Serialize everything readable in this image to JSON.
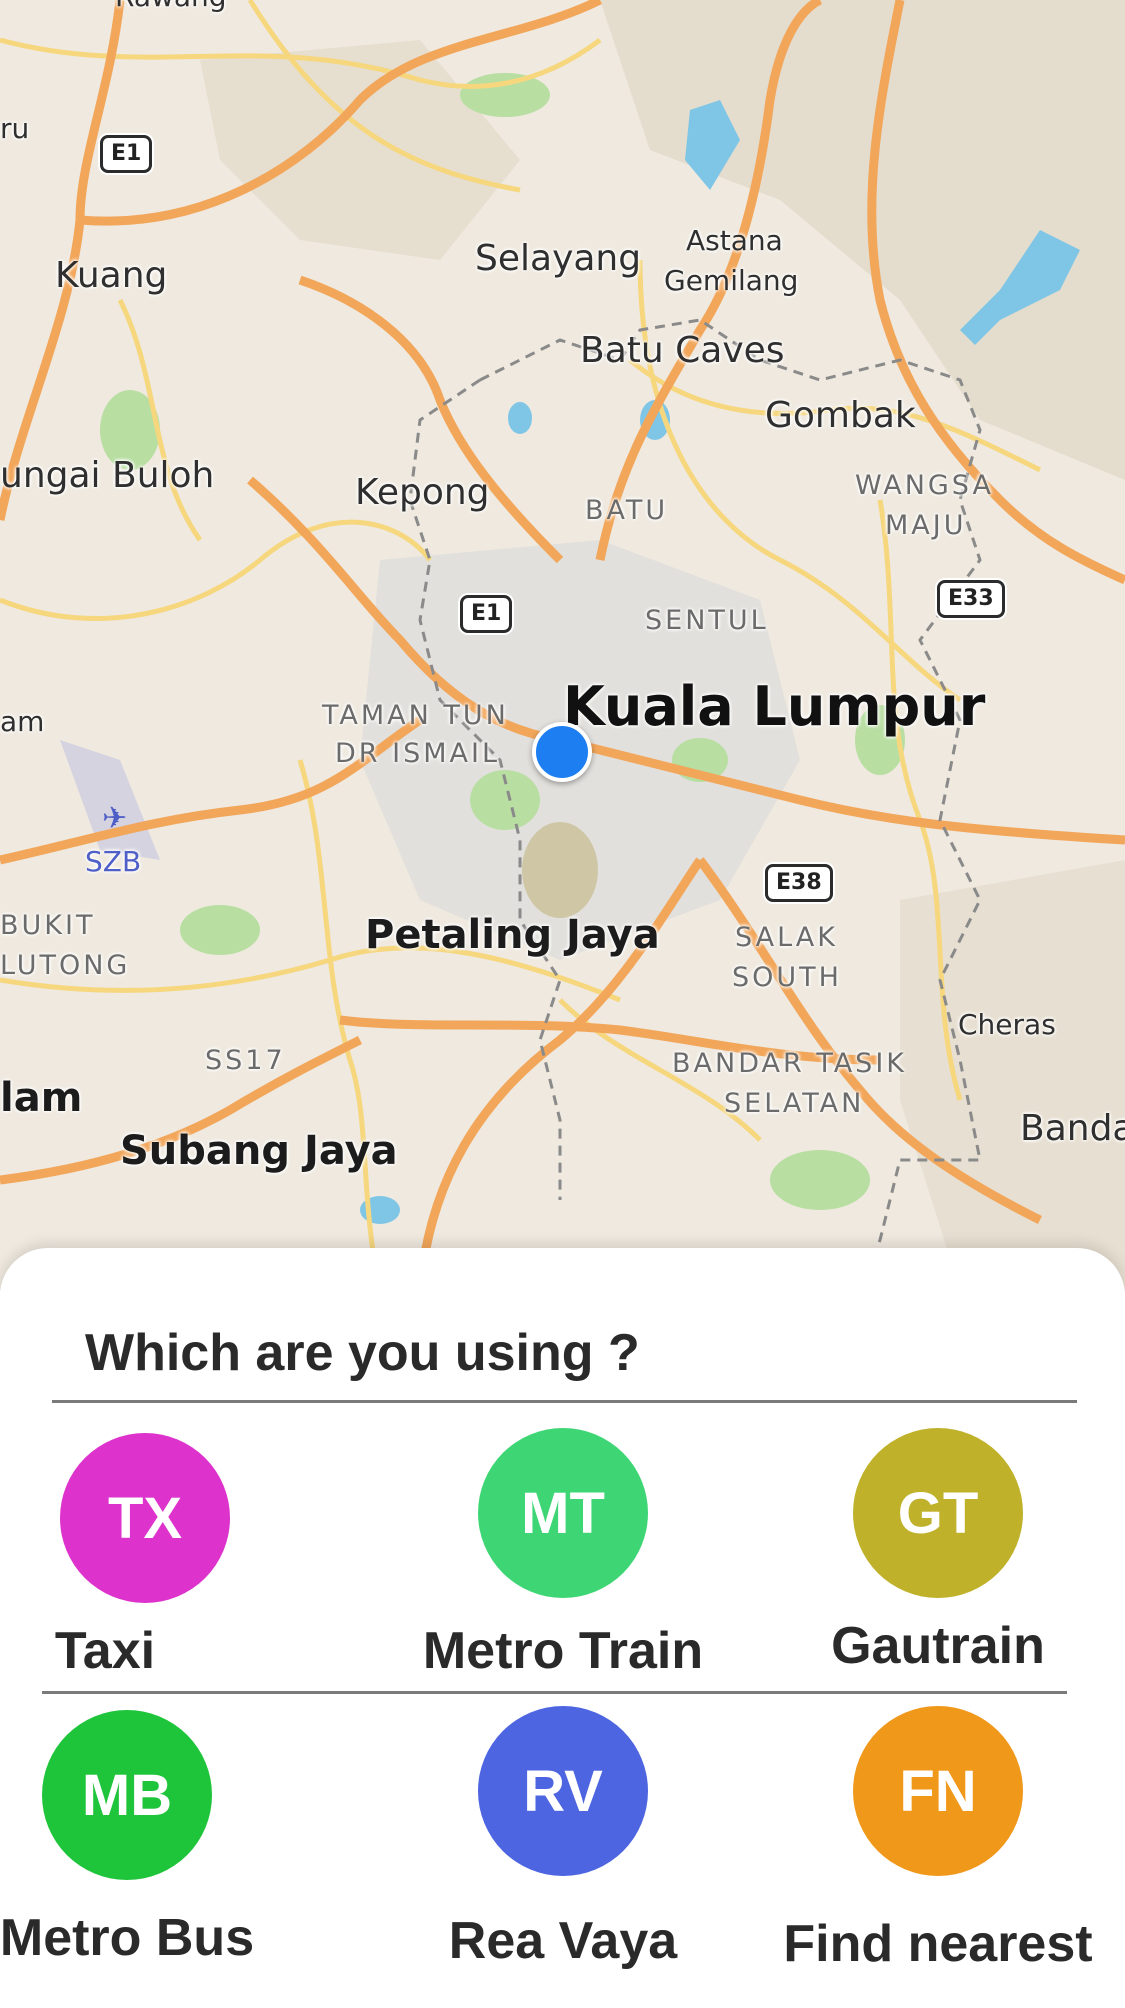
{
  "map": {
    "labels": {
      "rawang": "Rawang",
      "ru": "ru",
      "kuang": "Kuang",
      "selayang": "Selayang",
      "astana": "Astana",
      "gemilang": "Gemilang",
      "batu_caves": "Batu Caves",
      "gombak": "Gombak",
      "sungai_buloh": "ungai Buloh",
      "kepong": "Kepong",
      "batu": "BATU",
      "wangsa": "WANGSA",
      "maju": "MAJU",
      "sentul": "SENTUL",
      "am": "am",
      "taman_tun": "TAMAN TUN",
      "dr_ismail": "DR ISMAIL",
      "kuala_lumpur": "Kuala Lumpur",
      "szb": "SZB",
      "bukit": "BUKIT",
      "lutong": "LUTONG",
      "petaling_jaya": "Petaling Jaya",
      "salak": "SALAK",
      "south": "SOUTH",
      "cheras": "Cheras",
      "ss17": "SS17",
      "bandar_tasik": "BANDAR TASIK",
      "selatan": "SELATAN",
      "lam": "lam",
      "subang_jaya": "Subang Jaya",
      "banda": "Banda"
    },
    "shields": {
      "e1_north": "E1",
      "e1_center": "E1",
      "e33": "E33",
      "e38": "E38"
    },
    "colors": {
      "land": "#efe9df",
      "major_road": "#f2a65a",
      "secondary_road": "#f6d77e",
      "water": "#7fc6e6",
      "park": "#b8dea2",
      "location_dot": "#1d7ef2"
    }
  },
  "sheet": {
    "title": "Which are you using ?",
    "options": [
      {
        "initials": "TX",
        "label": "Taxi",
        "color": "#dd33cc"
      },
      {
        "initials": "MT",
        "label": "Metro Train",
        "color": "#3ed675"
      },
      {
        "initials": "GT",
        "label": "Gautrain",
        "color": "#bfb12a"
      },
      {
        "initials": "MB",
        "label": "Metro Bus",
        "color": "#1ec43a"
      },
      {
        "initials": "RV",
        "label": "Rea Vaya",
        "color": "#4d65e0"
      },
      {
        "initials": "FN",
        "label": "Find nearest",
        "color": "#f0981a"
      }
    ]
  }
}
